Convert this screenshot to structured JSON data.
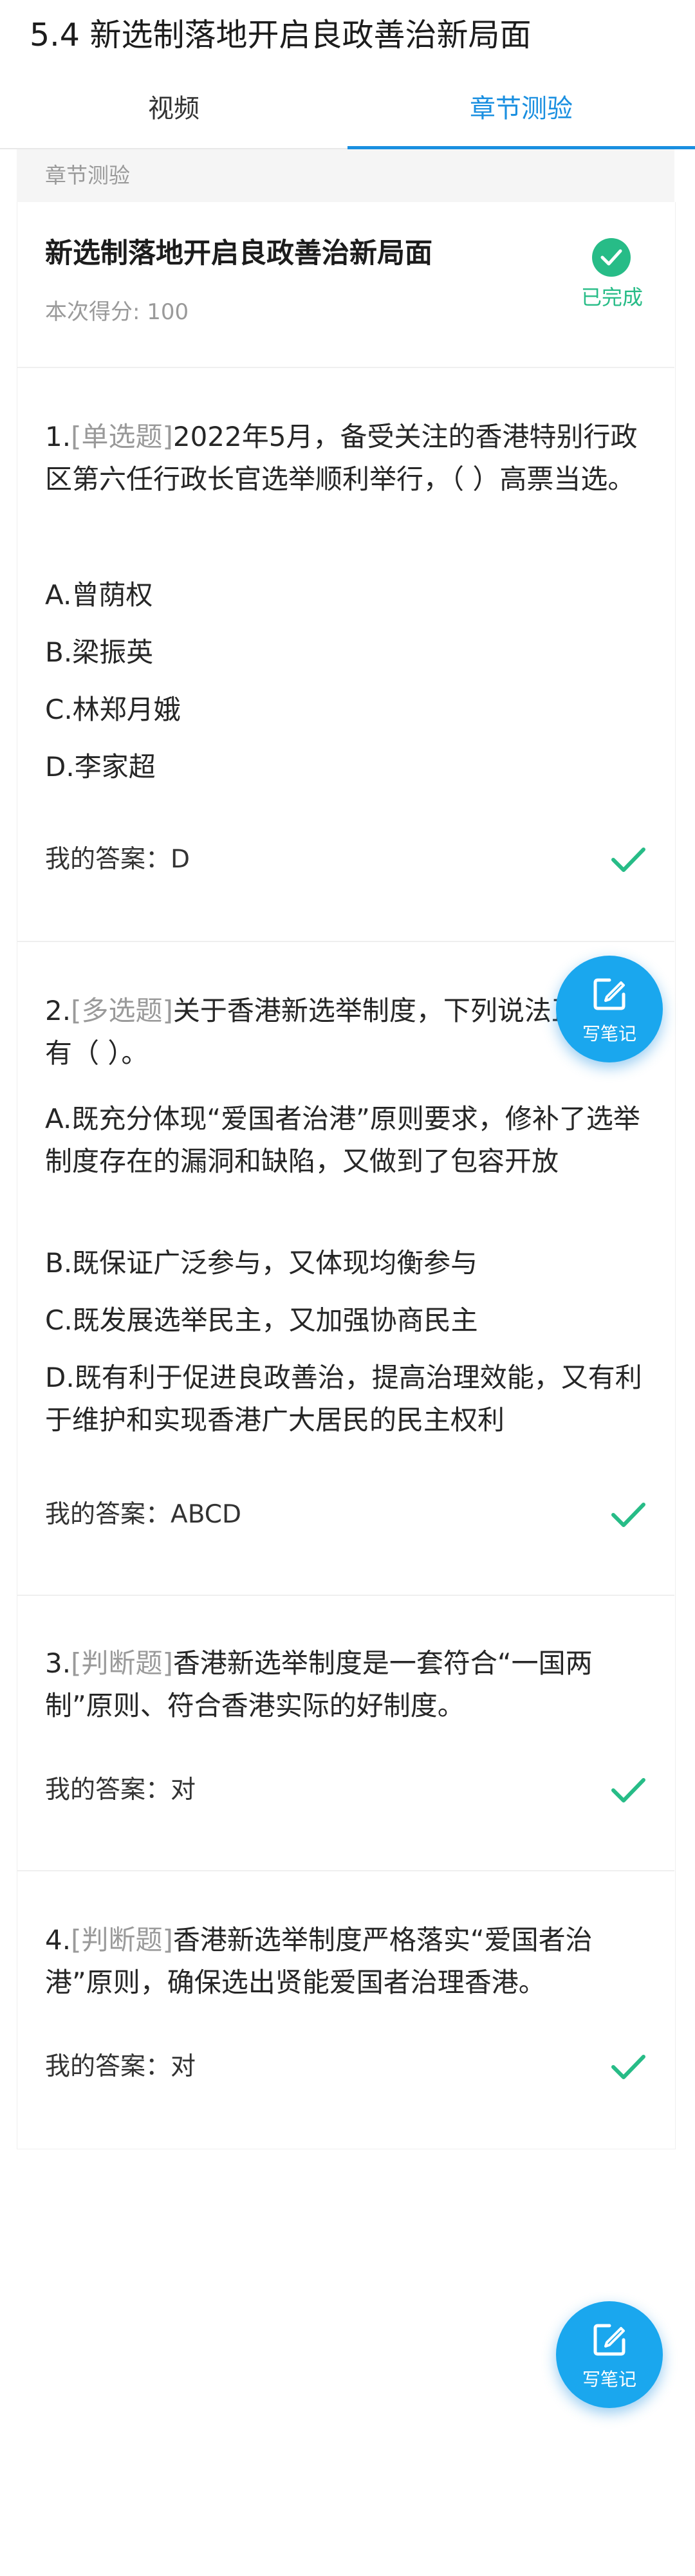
{
  "header": {
    "title": "5.4 新选制落地开启良政善治新局面"
  },
  "tabs": [
    {
      "label": "视频",
      "active": false
    },
    {
      "label": "章节测验",
      "active": true
    }
  ],
  "section": {
    "label": "章节测验"
  },
  "summary": {
    "title": "新选制落地开启良政善治新局面",
    "score_text": "本次得分: 100",
    "status": "已完成"
  },
  "questions": [
    {
      "num": "1.",
      "type": "[单选题]",
      "text": "2022年5月，备受关注的香港特别行政区第六任行政长官选举顺利举行，（ ）高票当选。",
      "options": [
        "A.曾荫权",
        "B.梁振英",
        "C.林郑月娥",
        "D.李家超"
      ],
      "answer_label": "我的答案：",
      "answer": "D",
      "correct": true
    },
    {
      "num": "2.",
      "type": "[多选题]",
      "text": "关于香港新选举制度，下列说法正确的有（ ）。",
      "options": [
        "A.既充分体现“爱国者治港”原则要求，修补了选举制度存在的漏洞和缺陷，又做到了包容开放",
        "B.既保证广泛参与，又体现均衡参与",
        "C.既发展选举民主，又加强协商民主",
        "D.既有利于促进良政善治，提高治理效能，又有利于维护和实现香港广大居民的民主权利"
      ],
      "answer_label": "我的答案：",
      "answer": "ABCD",
      "correct": true
    },
    {
      "num": "3.",
      "type": "[判断题]",
      "text": "香港新选举制度是一套符合“一国两制”原则、符合香港实际的好制度。",
      "options": [],
      "answer_label": "我的答案：",
      "answer": "对",
      "correct": true
    },
    {
      "num": "4.",
      "type": "[判断题]",
      "text": "香港新选举制度严格落实“爱国者治港”原则，确保选出贤能爱国者治理香港。",
      "options": [],
      "answer_label": "我的答案：",
      "answer": "对",
      "correct": true
    }
  ],
  "fab": {
    "label": "写笔记",
    "icon": "edit-note-icon"
  },
  "colors": {
    "accent": "#1a8fe0",
    "success": "#27bc87",
    "muted": "#9a9a9a",
    "fab": "#1aa7ee"
  }
}
